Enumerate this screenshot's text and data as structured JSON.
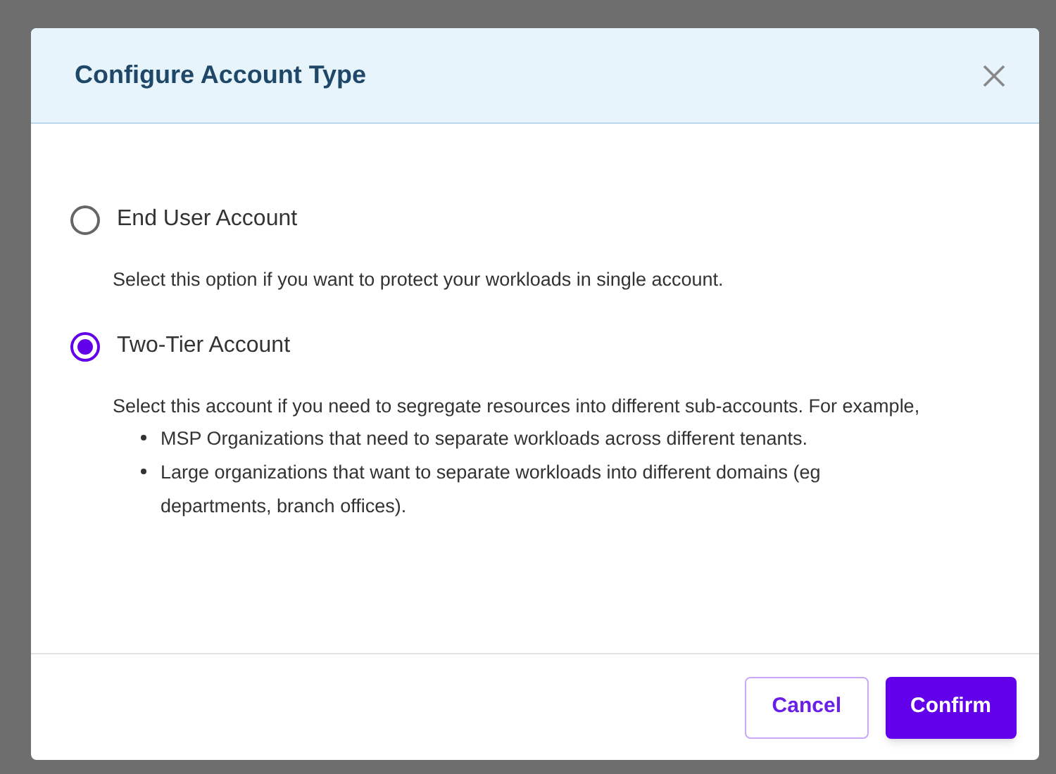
{
  "dialog": {
    "title": "Configure Account Type",
    "options": [
      {
        "label": "End User Account",
        "selected": false,
        "description": "Select this option if you want to protect your workloads in single account."
      },
      {
        "label": "Two-Tier Account",
        "selected": true,
        "description": "Select this account if you need to segregate resources into different sub-accounts. For example,",
        "bullets": [
          "MSP Organizations that need to separate workloads across different tenants.",
          "Large organizations that want to separate workloads into different domains (eg departments, branch offices)."
        ]
      }
    ],
    "buttons": [
      {
        "label": "Cancel",
        "kind": "secondary"
      },
      {
        "label": "Confirm",
        "kind": "primary"
      }
    ]
  }
}
